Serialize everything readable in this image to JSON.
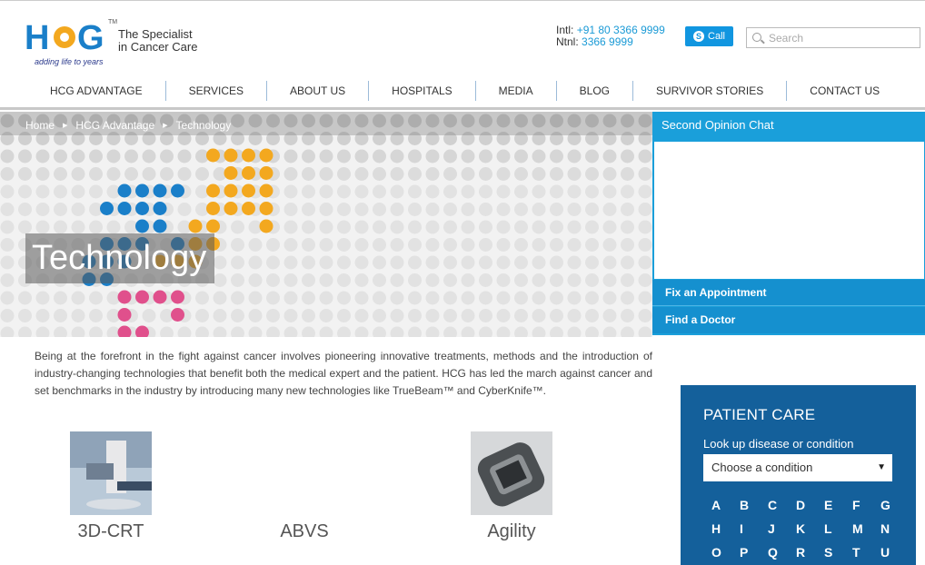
{
  "brand": {
    "logo_text": "HCG",
    "logo_tagline": "adding life to years",
    "specialist_line1": "The Specialist",
    "specialist_line2": "in Cancer Care",
    "colors": {
      "blue": "#1a7fc9",
      "orange": "#f3a81f",
      "pink": "#e0508c"
    }
  },
  "contact": {
    "intl_label": "Intl:",
    "intl_number": "+91 80 3366 9999",
    "ntnl_label": "Ntnl:",
    "ntnl_number": "3366 9999",
    "call_label": "Call",
    "call_icon": "skype-icon"
  },
  "search": {
    "placeholder": "Search",
    "icon": "search-icon"
  },
  "nav": [
    "HCG ADVANTAGE",
    "SERVICES",
    "ABOUT US",
    "HOSPITALS",
    "MEDIA",
    "BLOG",
    "SURVIVOR STORIES",
    "CONTACT US"
  ],
  "breadcrumb": [
    "Home",
    "HCG Advantage",
    "Technology"
  ],
  "banner_title": "Technology",
  "side_panel": {
    "chat_title": "Second Opinion Chat",
    "fix_appointment": "Fix an Appointment",
    "find_doctor": "Find a Doctor"
  },
  "intro": "Being at the forefront in the fight against cancer involves pioneering innovative treatments, methods and the introduction of industry-changing technologies that benefit both the medical expert and the patient. HCG has led the march against cancer and set benchmarks in the industry by introducing many new technologies like TrueBeam™ and CyberKnife™.",
  "technologies": [
    {
      "name": "3D-CRT"
    },
    {
      "name": "ABVS"
    },
    {
      "name": "Agility"
    }
  ],
  "patient_care": {
    "title": "PATIENT CARE",
    "subtitle": "Look up disease or condition",
    "select_value": "Choose a condition",
    "letters": [
      "A",
      "B",
      "C",
      "D",
      "E",
      "F",
      "G",
      "H",
      "I",
      "J",
      "K",
      "L",
      "M",
      "N",
      "O",
      "P",
      "Q",
      "R",
      "S",
      "T",
      "U"
    ]
  }
}
